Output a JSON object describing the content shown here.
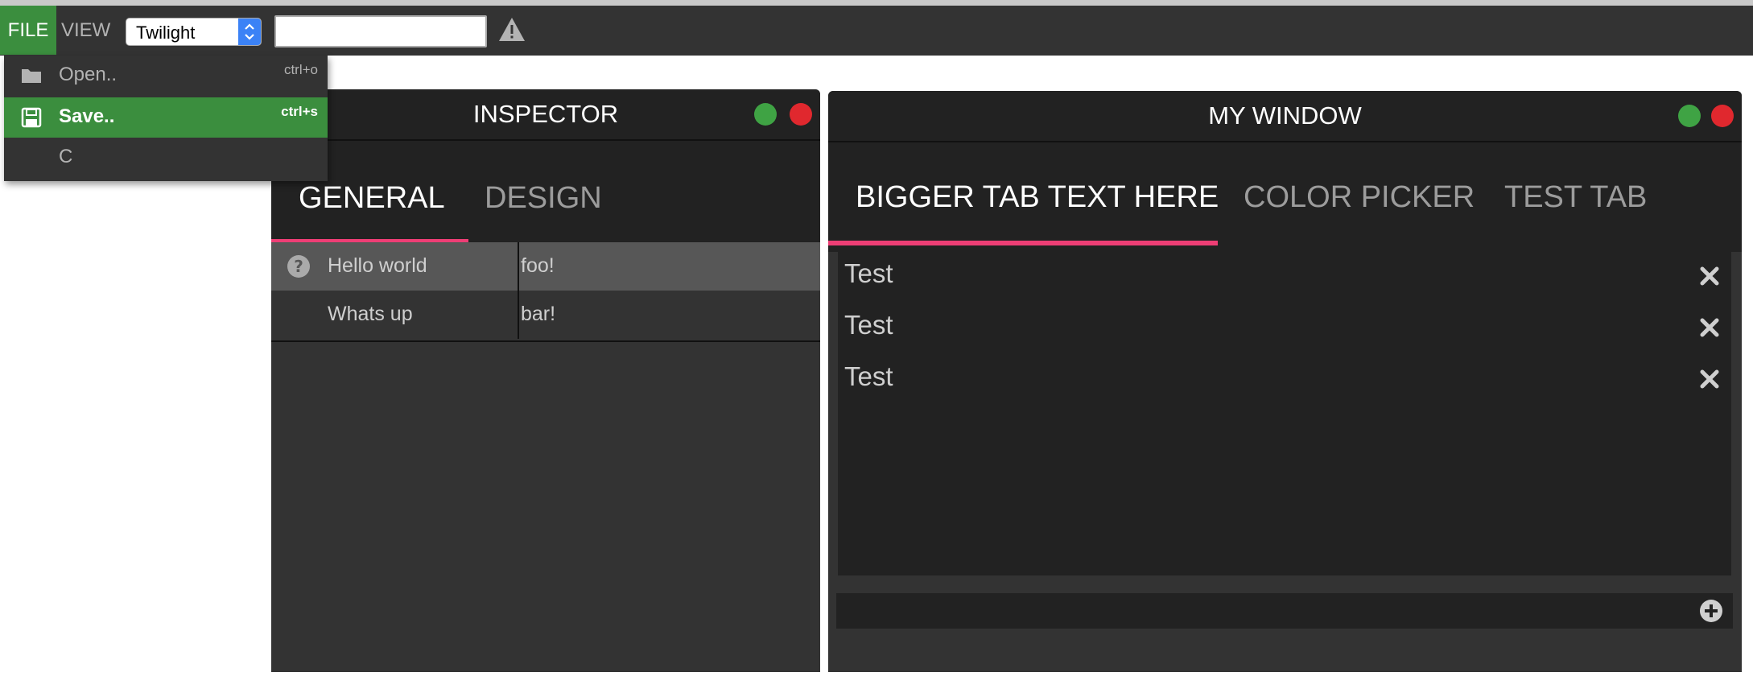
{
  "menubar": {
    "file_label": "FILE",
    "view_label": "VIEW",
    "theme_select_value": "Twilight",
    "text_input_value": "",
    "icons": [
      "warning-icon"
    ]
  },
  "file_menu": {
    "items": [
      {
        "label": "Open..",
        "shortcut": "ctrl+o",
        "icon": "folder-icon"
      },
      {
        "label": "Save..",
        "shortcut": "ctrl+s",
        "icon": "floppy-disk-icon",
        "highlighted": true
      },
      {
        "label": "C",
        "shortcut": "",
        "icon": ""
      }
    ]
  },
  "inspector": {
    "title": "INSPECTOR",
    "tabs": [
      {
        "label": "GENERAL",
        "active": true
      },
      {
        "label": "DESIGN",
        "active": false
      }
    ],
    "rows": [
      {
        "key": "Hello world",
        "value": "foo!",
        "icon": "question-circle-icon",
        "highlighted": true
      },
      {
        "key": "Whats up",
        "value": "bar!",
        "icon": "",
        "highlighted": false
      }
    ]
  },
  "my_window": {
    "title": "MY WINDOW",
    "tabs": [
      {
        "label": "BIGGER TAB TEXT HERE",
        "active": true
      },
      {
        "label": "COLOR PICKER",
        "active": false
      },
      {
        "label": "TEST TAB",
        "active": false
      }
    ],
    "items": [
      "Test",
      "Test",
      "Test"
    ]
  },
  "colors": {
    "accent_green": "#3b8e3e",
    "tab_underline": "#ee3e75",
    "close_red": "#e0282e",
    "maximize_green": "#3fa344",
    "panel_bg": "#333333",
    "titlebar_bg": "#222222"
  }
}
